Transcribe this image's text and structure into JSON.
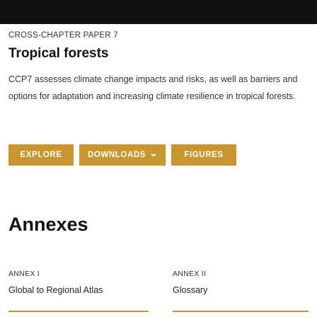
{
  "header": {
    "eyebrow": "CROSS-CHAPTER PAPER 7",
    "title": "Tropical forests",
    "description": "CCP7 assesses climate change impacts and risks, as well as barriers and options for adaptation and increasing climate resilience in tropical forests."
  },
  "buttons": {
    "explore": "EXPLORE",
    "downloads": "DOWNLOADS",
    "figures": "FIGURES"
  },
  "annexes": {
    "heading": "Annexes",
    "items": [
      {
        "label": "ANNEX I",
        "title": "Global to Regional Atlas"
      },
      {
        "label": "ANNEX II",
        "title": "Glossary"
      }
    ]
  },
  "colors": {
    "accent": "#c8952e",
    "hero": "#111111"
  },
  "icons": {
    "downloads_caret": "chevron-down-icon"
  }
}
